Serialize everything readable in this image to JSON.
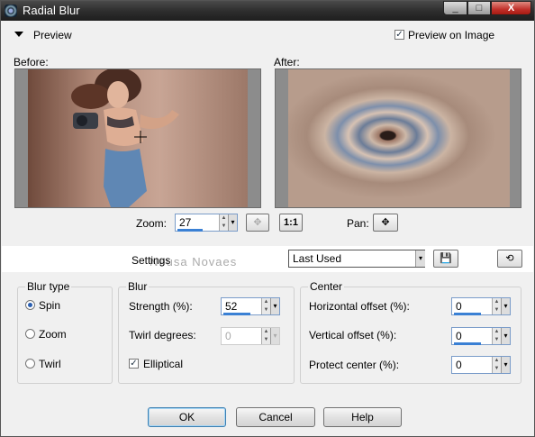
{
  "window": {
    "title": "Radial Blur",
    "minimize": "_",
    "maximize": "□",
    "close": "X"
  },
  "preview": {
    "section_label": "Preview",
    "preview_on_image_label": "Preview on Image",
    "preview_on_image_checked": true
  },
  "images": {
    "before_label": "Before:",
    "after_label": "After:"
  },
  "zoom": {
    "label": "Zoom:",
    "value": "27",
    "one_to_one": "1:1"
  },
  "pan": {
    "label": "Pan:"
  },
  "settings": {
    "label": "Settings",
    "selected": "Last Used",
    "watermark": "Neusa Novaes"
  },
  "blur_type": {
    "title": "Blur type",
    "options": [
      {
        "label": "Spin",
        "selected": true
      },
      {
        "label": "Zoom",
        "selected": false
      },
      {
        "label": "Twirl",
        "selected": false
      }
    ]
  },
  "blur": {
    "title": "Blur",
    "strength_label": "Strength (%):",
    "strength_value": "52",
    "twirl_label": "Twirl degrees:",
    "twirl_value": "0",
    "elliptical_label": "Elliptical",
    "elliptical_checked": true
  },
  "center": {
    "title": "Center",
    "horizontal_label": "Horizontal offset (%):",
    "horizontal_value": "0",
    "vertical_label": "Vertical offset (%):",
    "vertical_value": "0",
    "protect_label": "Protect center (%):",
    "protect_value": "0"
  },
  "buttons": {
    "ok": "OK",
    "cancel": "Cancel",
    "help": "Help"
  },
  "colors": {
    "accent": "#3a80d4",
    "title_bar": "#2e2e2e",
    "close": "#c1302a"
  }
}
